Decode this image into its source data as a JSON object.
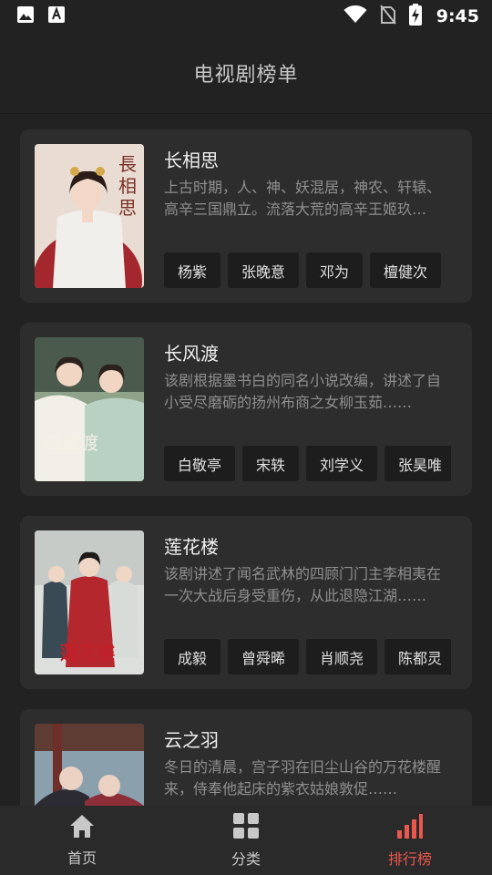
{
  "status_bar": {
    "time": "9:45"
  },
  "header": {
    "title": "电视剧榜单"
  },
  "dramas": [
    {
      "title": "长相思",
      "description": "上古时期，人、神、妖混居，神农、轩辕、高辛三国鼎立。流落大荒的高辛王姬玖瑶……",
      "cast": [
        "杨紫",
        "张晚意",
        "邓为",
        "檀健次"
      ],
      "poster_text": "長相思"
    },
    {
      "title": "长风渡",
      "description": "该剧根据墨书白的同名小说改编，讲述了自小受尽磨砺的扬州布商之女柳玉茹……",
      "cast": [
        "白敬亭",
        "宋轶",
        "刘学义",
        "张昊唯"
      ],
      "poster_text": "長風渡"
    },
    {
      "title": "莲花楼",
      "description": "该剧讲述了闻名武林的四顾门门主李相夷在一次大战后身受重伤，从此退隐江湖……",
      "cast": [
        "成毅",
        "曾舜晞",
        "肖顺尧",
        "陈都灵"
      ],
      "poster_text": "蓮花樓"
    },
    {
      "title": "云之羽",
      "description": "冬日的清晨，宫子羽在旧尘山谷的万花楼醒来，侍奉他起床的紫衣姑娘敦促……",
      "cast": [],
      "poster_text": ""
    }
  ],
  "bottom_nav": [
    {
      "label": "首页",
      "icon": "home-icon",
      "active": false
    },
    {
      "label": "分类",
      "icon": "grid-icon",
      "active": false
    },
    {
      "label": "排行榜",
      "icon": "ranking-chart-icon",
      "active": true
    }
  ],
  "colors": {
    "accent": "#e9574e",
    "background": "#222222",
    "card": "#2d2d2d",
    "tag": "#1d1d1d"
  }
}
